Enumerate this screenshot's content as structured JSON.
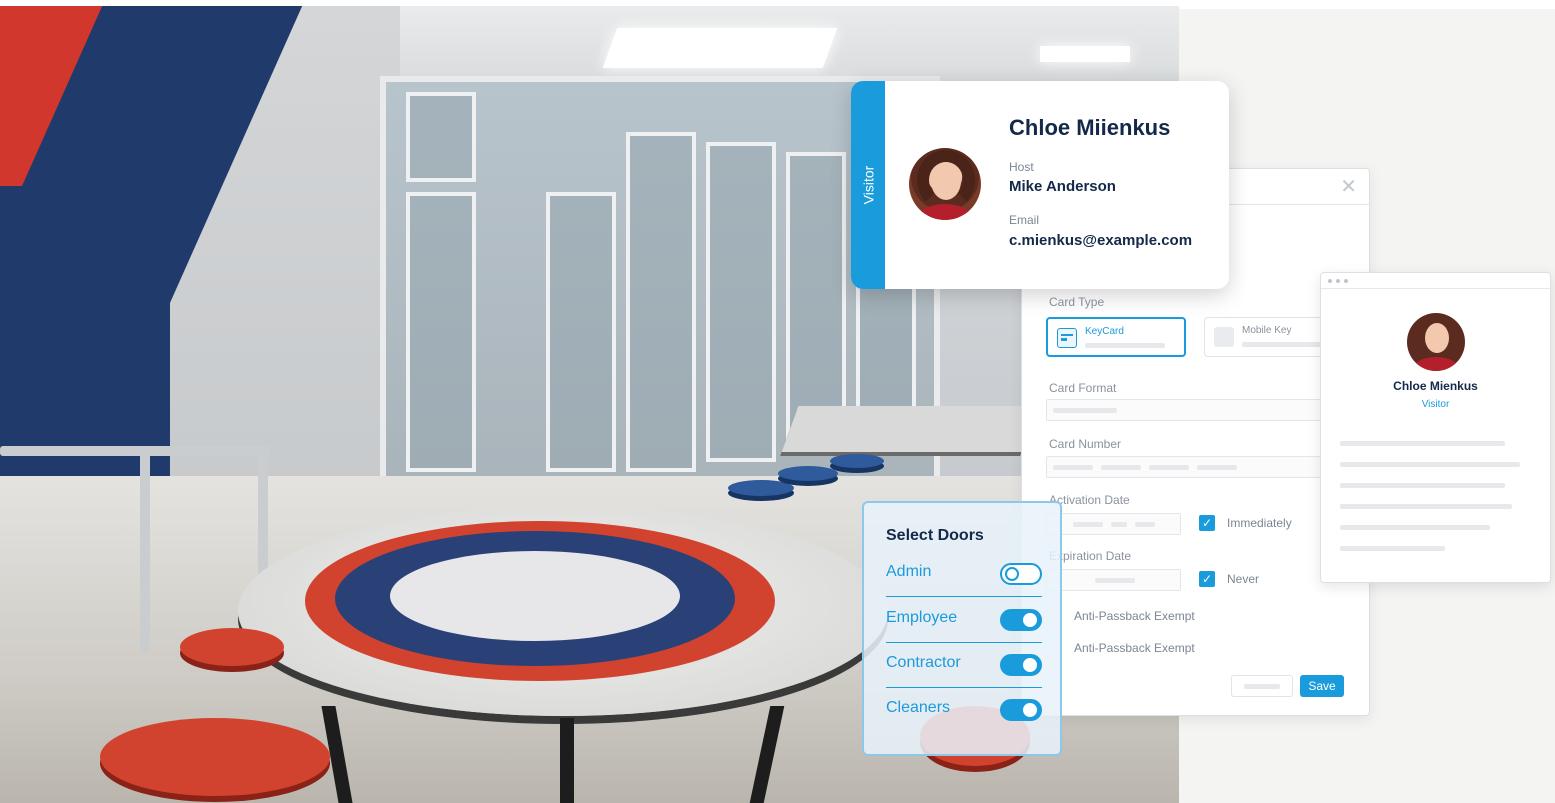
{
  "visitor_card": {
    "tab_label": "Visitor",
    "name": "Chloe Miienkus",
    "host_label": "Host",
    "host_value": "Mike Anderson",
    "email_label": "Email",
    "email_value": "c.mienkus@example.com"
  },
  "form": {
    "card_type_label": "Card Type",
    "card_types": [
      {
        "label": "KeyCard",
        "selected": true
      },
      {
        "label": "Mobile Key",
        "selected": false
      }
    ],
    "card_format_label": "Card Format",
    "card_number_label": "Card Number",
    "activation_date_label": "Activation Date",
    "activation_option": "Immediately",
    "expiration_date_label": "Expiration Date",
    "expiration_option": "Never",
    "anti_passback_1": "Anti-Passback Exempt",
    "anti_passback_2": "Anti-Passback Exempt",
    "save_label": "Save"
  },
  "profile": {
    "name": "Chloe Mienkus",
    "role": "Visitor"
  },
  "select_doors": {
    "title": "Select Doors",
    "doors": [
      {
        "label": "Admin",
        "enabled": false
      },
      {
        "label": "Employee",
        "enabled": true
      },
      {
        "label": "Contractor",
        "enabled": true
      },
      {
        "label": "Cleaners",
        "enabled": true
      }
    ]
  },
  "colors": {
    "accent": "#1a9bdc",
    "text_dark": "#14284a",
    "text_muted": "#7b8594"
  },
  "icons": {
    "close": "close-icon",
    "keycard": "keycard-icon",
    "mobile_key": "mobile-key-icon",
    "check": "check-icon"
  }
}
